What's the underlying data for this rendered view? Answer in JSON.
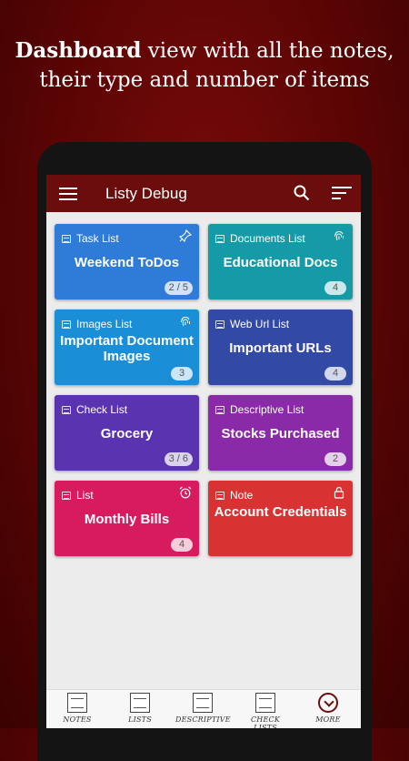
{
  "headline": {
    "bold": "Dashboard",
    "rest_line1": " view with all the notes,",
    "line2": "their type and number of items"
  },
  "app": {
    "title": "Listy Debug"
  },
  "icons": {
    "menu": "menu-icon",
    "search": "search-icon",
    "sort": "sort-icon"
  },
  "cards": [
    {
      "type": "Task List",
      "title": "Weekend ToDos",
      "count": "2 / 5",
      "color": "#2e7bd8",
      "corner_icon": "pin-icon"
    },
    {
      "type": "Documents List",
      "title": "Educational Docs",
      "count": "4",
      "color": "#159aa8",
      "corner_icon": "fingerprint-icon"
    },
    {
      "type": "Images List",
      "title": "Important Document Images",
      "count": "3",
      "color": "#1a8fd8",
      "corner_icon": "fingerprint-icon"
    },
    {
      "type": "Web Url List",
      "title": "Important URLs",
      "count": "4",
      "color": "#3349a6",
      "corner_icon": ""
    },
    {
      "type": "Check List",
      "title": "Grocery",
      "count": "3 / 6",
      "color": "#5a33b0",
      "corner_icon": ""
    },
    {
      "type": "Descriptive List",
      "title": "Stocks Purchased",
      "count": "2",
      "color": "#8a2aa8",
      "corner_icon": ""
    },
    {
      "type": "List",
      "title": "Monthly Bills",
      "count": "4",
      "color": "#d81b5e",
      "corner_icon": "alarm-icon"
    },
    {
      "type": "Note",
      "title": "Account Credentials",
      "count": "",
      "color": "#d93232",
      "corner_icon": "lock-icon"
    }
  ],
  "bottom_nav": [
    {
      "label": "NOTES",
      "icon": "notes-icon"
    },
    {
      "label": "LISTS",
      "icon": "lists-icon"
    },
    {
      "label": "DESCRIPTIVE",
      "icon": "descriptive-icon"
    },
    {
      "label": "CHECK LISTS",
      "icon": "checklist-icon"
    },
    {
      "label": "MORE",
      "icon": "more-icon"
    }
  ]
}
